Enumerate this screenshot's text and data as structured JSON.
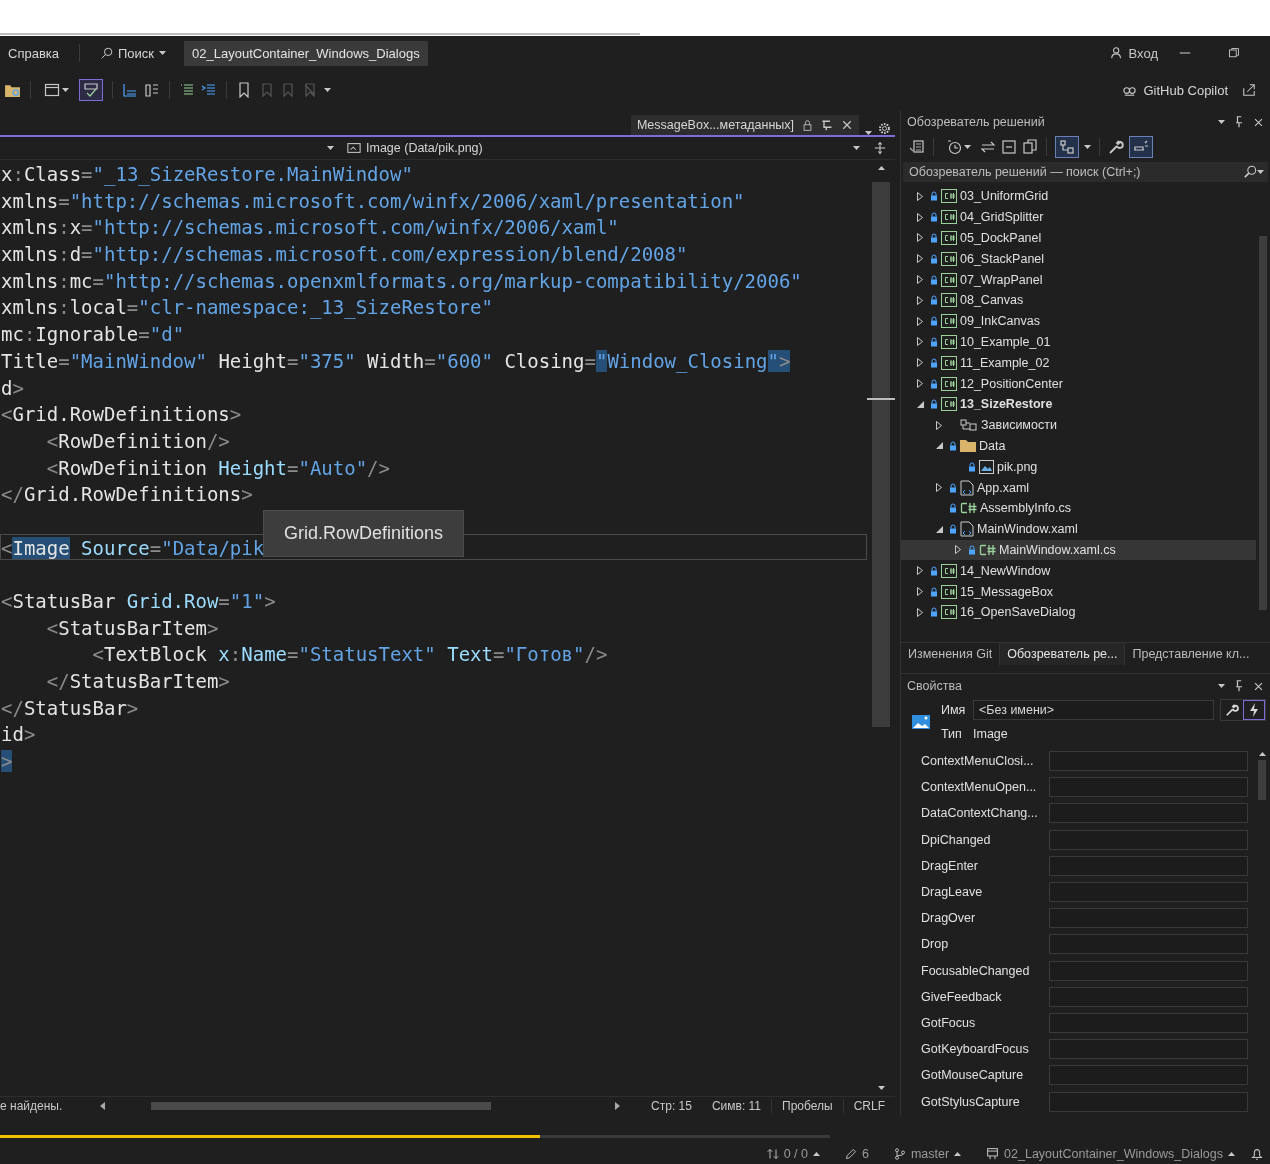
{
  "menu_bar": {
    "items": [
      "Справка",
      "Поиск"
    ],
    "solution_title": "02_LayoutContainer_Windows_Dialogs",
    "sign_in": "Вход",
    "copilot": "GitHub Copilot"
  },
  "toolbar": {
    "spell_check": {
      "on": true
    }
  },
  "editor": {
    "tab": "MessageBox...метаданных]",
    "nav_right": "Image (Data/pik.png)",
    "lines": [
      {
        "current": false,
        "tokens": [
          {
            "text": "x",
            "kind": "name"
          },
          {
            "text": ":",
            "kind": "punct"
          },
          {
            "text": "Class",
            "kind": "name"
          },
          {
            "text": "=",
            "kind": "punct"
          },
          {
            "text": "\"_13_SizeRestore.MainWindow\"",
            "kind": "str"
          }
        ]
      },
      {
        "current": false,
        "tokens": [
          {
            "text": "xmlns",
            "kind": "name"
          },
          {
            "text": "=",
            "kind": "punct"
          },
          {
            "text": "\"http://schemas.microsoft.com/winfx/2006/xaml/presentation\"",
            "kind": "str"
          }
        ]
      },
      {
        "current": false,
        "tokens": [
          {
            "text": "xmlns",
            "kind": "name"
          },
          {
            "text": ":",
            "kind": "punct"
          },
          {
            "text": "x",
            "kind": "name"
          },
          {
            "text": "=",
            "kind": "punct"
          },
          {
            "text": "\"http://schemas.microsoft.com/winfx/2006/xaml\"",
            "kind": "str"
          }
        ]
      },
      {
        "current": false,
        "tokens": [
          {
            "text": "xmlns",
            "kind": "name"
          },
          {
            "text": ":",
            "kind": "punct"
          },
          {
            "text": "d",
            "kind": "name"
          },
          {
            "text": "=",
            "kind": "punct"
          },
          {
            "text": "\"http://schemas.microsoft.com/expression/blend/2008\"",
            "kind": "str"
          }
        ]
      },
      {
        "current": false,
        "tokens": [
          {
            "text": "xmlns",
            "kind": "name"
          },
          {
            "text": ":",
            "kind": "punct"
          },
          {
            "text": "mc",
            "kind": "name"
          },
          {
            "text": "=",
            "kind": "punct"
          },
          {
            "text": "\"http://schemas.openxmlformats.org/markup-compatibility/2006\"",
            "kind": "str"
          }
        ]
      },
      {
        "current": false,
        "tokens": [
          {
            "text": "xmlns",
            "kind": "name"
          },
          {
            "text": ":",
            "kind": "punct"
          },
          {
            "text": "local",
            "kind": "name"
          },
          {
            "text": "=",
            "kind": "punct"
          },
          {
            "text": "\"clr-namespace:_13_SizeRestore\"",
            "kind": "str"
          }
        ]
      },
      {
        "current": false,
        "tokens": [
          {
            "text": "mc",
            "kind": "name"
          },
          {
            "text": ":",
            "kind": "punct"
          },
          {
            "text": "Ignorable",
            "kind": "name"
          },
          {
            "text": "=",
            "kind": "punct"
          },
          {
            "text": "\"d\"",
            "kind": "str"
          }
        ]
      },
      {
        "current": false,
        "tokens": [
          {
            "text": "Title",
            "kind": "name"
          },
          {
            "text": "=",
            "kind": "punct"
          },
          {
            "text": "\"MainWindow\"",
            "kind": "str"
          },
          {
            "text": " Height",
            "kind": "name"
          },
          {
            "text": "=",
            "kind": "punct"
          },
          {
            "text": "\"375\"",
            "kind": "str"
          },
          {
            "text": " Width",
            "kind": "name"
          },
          {
            "text": "=",
            "kind": "punct"
          },
          {
            "text": "\"600\"",
            "kind": "str"
          },
          {
            "text": " Closing",
            "kind": "name"
          },
          {
            "text": "=",
            "kind": "punct"
          },
          {
            "text": "\"",
            "kind": "str",
            "highlighted": true
          },
          {
            "text": "Window_Closing",
            "kind": "str"
          },
          {
            "text": "\"",
            "kind": "str",
            "highlighted": true
          },
          {
            "text": ">",
            "kind": "punct",
            "highlighted": true
          }
        ]
      },
      {
        "current": false,
        "tokens": [
          {
            "text": "d",
            "kind": "tag"
          },
          {
            "text": ">",
            "kind": "punct"
          }
        ]
      },
      {
        "current": false,
        "tokens": [
          {
            "text": "<",
            "kind": "punct"
          },
          {
            "text": "Grid.RowDefinitions",
            "kind": "tag"
          },
          {
            "text": ">",
            "kind": "punct"
          }
        ]
      },
      {
        "current": false,
        "tokens": [
          {
            "text": "    <",
            "kind": "punct"
          },
          {
            "text": "RowDefinition",
            "kind": "tag"
          },
          {
            "text": "/>",
            "kind": "punct"
          }
        ]
      },
      {
        "current": false,
        "tokens": [
          {
            "text": "    <",
            "kind": "punct"
          },
          {
            "text": "RowDefinition",
            "kind": "tag"
          },
          {
            "text": " Height",
            "kind": "attr"
          },
          {
            "text": "=",
            "kind": "punct"
          },
          {
            "text": "\"Auto\"",
            "kind": "str"
          },
          {
            "text": "/>",
            "kind": "punct"
          }
        ]
      },
      {
        "current": false,
        "tokens": [
          {
            "text": "</",
            "kind": "punct"
          },
          {
            "text": "Grid.RowDefinitions",
            "kind": "tag"
          },
          {
            "text": ">",
            "kind": "punct"
          }
        ]
      },
      {
        "current": false
      },
      {
        "current": true,
        "tokens": [
          {
            "text": "<",
            "kind": "punct"
          },
          {
            "text": "Image",
            "kind": "tag",
            "highlighted": true
          },
          {
            "text": " Source",
            "kind": "attr"
          },
          {
            "text": "=",
            "kind": "punct"
          },
          {
            "text": "\"Data/pik",
            "kind": "str"
          }
        ]
      },
      {
        "current": false
      },
      {
        "current": false,
        "tokens": [
          {
            "text": "<",
            "kind": "punct"
          },
          {
            "text": "StatusBar",
            "kind": "tag"
          },
          {
            "text": " Grid.Row",
            "kind": "attr"
          },
          {
            "text": "=",
            "kind": "punct"
          },
          {
            "text": "\"1\"",
            "kind": "str"
          },
          {
            "text": ">",
            "kind": "punct"
          }
        ]
      },
      {
        "current": false,
        "tokens": [
          {
            "text": "    <",
            "kind": "punct"
          },
          {
            "text": "StatusBarItem",
            "kind": "tag"
          },
          {
            "text": ">",
            "kind": "punct"
          }
        ]
      },
      {
        "current": false,
        "tokens": [
          {
            "text": "        <",
            "kind": "punct"
          },
          {
            "text": "TextBlock",
            "kind": "tag"
          },
          {
            "text": " x",
            "kind": "attr"
          },
          {
            "text": ":",
            "kind": "punct"
          },
          {
            "text": "Name",
            "kind": "attr"
          },
          {
            "text": "=",
            "kind": "punct"
          },
          {
            "text": "\"StatusText\"",
            "kind": "str"
          },
          {
            "text": " Text",
            "kind": "attr"
          },
          {
            "text": "=",
            "kind": "punct"
          },
          {
            "text": "\"Готов\"",
            "kind": "str"
          },
          {
            "text": "/>",
            "kind": "punct"
          }
        ]
      },
      {
        "current": false,
        "tokens": [
          {
            "text": "    </",
            "kind": "punct"
          },
          {
            "text": "StatusBarItem",
            "kind": "tag"
          },
          {
            "text": ">",
            "kind": "punct"
          }
        ]
      },
      {
        "current": false,
        "tokens": [
          {
            "text": "</",
            "kind": "punct"
          },
          {
            "text": "StatusBar",
            "kind": "tag"
          },
          {
            "text": ">",
            "kind": "punct"
          }
        ]
      },
      {
        "current": false,
        "tokens": [
          {
            "text": "id",
            "kind": "tag"
          },
          {
            "text": ">",
            "kind": "punct"
          }
        ]
      },
      {
        "current": false,
        "tokens": [
          {
            "text": ">",
            "kind": "punct",
            "highlighted": true
          }
        ]
      }
    ],
    "tooltip": "Grid.RowDefinitions",
    "status": {
      "message": "е найдены.",
      "line": "Стр: 15",
      "column": "Симв: 11",
      "whitespace": "Пробелы",
      "line_endings": "CRLF"
    }
  },
  "solution_explorer": {
    "title": "Обозреватель решений",
    "toolbar": {
      "diagram_view": {
        "on": true
      },
      "preview_selected": {
        "on": true
      }
    },
    "search": {
      "placeholder": "Обозреватель решений — поиск (Ctrl+;)"
    },
    "tree": [
      {
        "label": "03_UniformGrid",
        "kind": "project",
        "locked": true,
        "startup": false,
        "expanded": false,
        "selected": false
      },
      {
        "label": "04_GridSplitter",
        "kind": "project",
        "locked": true,
        "startup": false,
        "expanded": false,
        "selected": false
      },
      {
        "label": "05_DockPanel",
        "kind": "project",
        "locked": true,
        "startup": false,
        "expanded": false,
        "selected": false
      },
      {
        "label": "06_StackPanel",
        "kind": "project",
        "locked": true,
        "startup": false,
        "expanded": false,
        "selected": false
      },
      {
        "label": "07_WrapPanel",
        "kind": "project",
        "locked": true,
        "startup": false,
        "expanded": false,
        "selected": false
      },
      {
        "label": "08_Canvas",
        "kind": "project",
        "locked": true,
        "startup": false,
        "expanded": false,
        "selected": false
      },
      {
        "label": "09_InkCanvas",
        "kind": "project",
        "locked": true,
        "startup": false,
        "expanded": false,
        "selected": false
      },
      {
        "label": "10_Example_01",
        "kind": "project",
        "locked": true,
        "startup": false,
        "expanded": false,
        "selected": false
      },
      {
        "label": "11_Example_02",
        "kind": "project",
        "locked": true,
        "startup": false,
        "expanded": false,
        "selected": false
      },
      {
        "label": "12_PositionCenter",
        "kind": "project",
        "locked": true,
        "startup": false,
        "expanded": false,
        "selected": false
      },
      {
        "label": "13_SizeRestore",
        "kind": "project",
        "locked": true,
        "startup": true,
        "expanded": true,
        "selected": false,
        "children": [
          {
            "label": "Зависимости",
            "kind": "dependencies",
            "locked": false,
            "startup": false,
            "expanded": false,
            "selected": false
          },
          {
            "label": "Data",
            "kind": "folder",
            "locked": true,
            "startup": false,
            "expanded": true,
            "selected": false,
            "children": [
              {
                "label": "pik.png",
                "kind": "image",
                "locked": true,
                "startup": false,
                "selected": false
              }
            ]
          },
          {
            "label": "App.xaml",
            "kind": "xaml",
            "locked": true,
            "startup": false,
            "expanded": false,
            "selected": false
          },
          {
            "label": "AssemblyInfo.cs",
            "kind": "csharp",
            "locked": true,
            "startup": false,
            "selected": false
          },
          {
            "label": "MainWindow.xaml",
            "kind": "xaml",
            "locked": true,
            "startup": false,
            "expanded": true,
            "selected": false,
            "children": [
              {
                "label": "MainWindow.xaml.cs",
                "kind": "csharp",
                "locked": true,
                "startup": false,
                "expanded": false,
                "selected": true
              }
            ]
          }
        ]
      },
      {
        "label": "14_NewWindow",
        "kind": "project",
        "locked": true,
        "startup": false,
        "expanded": false,
        "selected": false
      },
      {
        "label": "15_MessageBox",
        "kind": "project",
        "locked": true,
        "startup": false,
        "expanded": false,
        "selected": false
      },
      {
        "label": "16_OpenSaveDialog",
        "kind": "project",
        "locked": true,
        "startup": false,
        "expanded": false,
        "selected": false
      }
    ],
    "tabs": [
      {
        "label": "Изменения Git",
        "selected": false
      },
      {
        "label": "Обозреватель ре...",
        "selected": true
      },
      {
        "label": "Представление кл...",
        "selected": false
      }
    ]
  },
  "properties": {
    "title": "Свойства",
    "name_label": "Имя",
    "name_value": "<Без имени>",
    "type_label": "Тип",
    "type_value": "Image",
    "modes": [
      {
        "kind": "properties",
        "selected": false
      },
      {
        "kind": "events",
        "selected": true
      }
    ],
    "events": [
      "ContextMenuClosi...",
      "ContextMenuOpen...",
      "DataContextChang...",
      "DpiChanged",
      "DragEnter",
      "DragLeave",
      "DragOver",
      "Drop",
      "FocusableChanged",
      "GiveFeedback",
      "GotFocus",
      "GotKeyboardFocus",
      "GotMouseCapture",
      "GotStylusCapture"
    ]
  },
  "progress": {
    "level": 0.65
  },
  "status_bar": {
    "sync": "0 / 0",
    "edits": "6",
    "branch": "master",
    "repo": "02_LayoutContainer_Windows_Dialogs"
  }
}
